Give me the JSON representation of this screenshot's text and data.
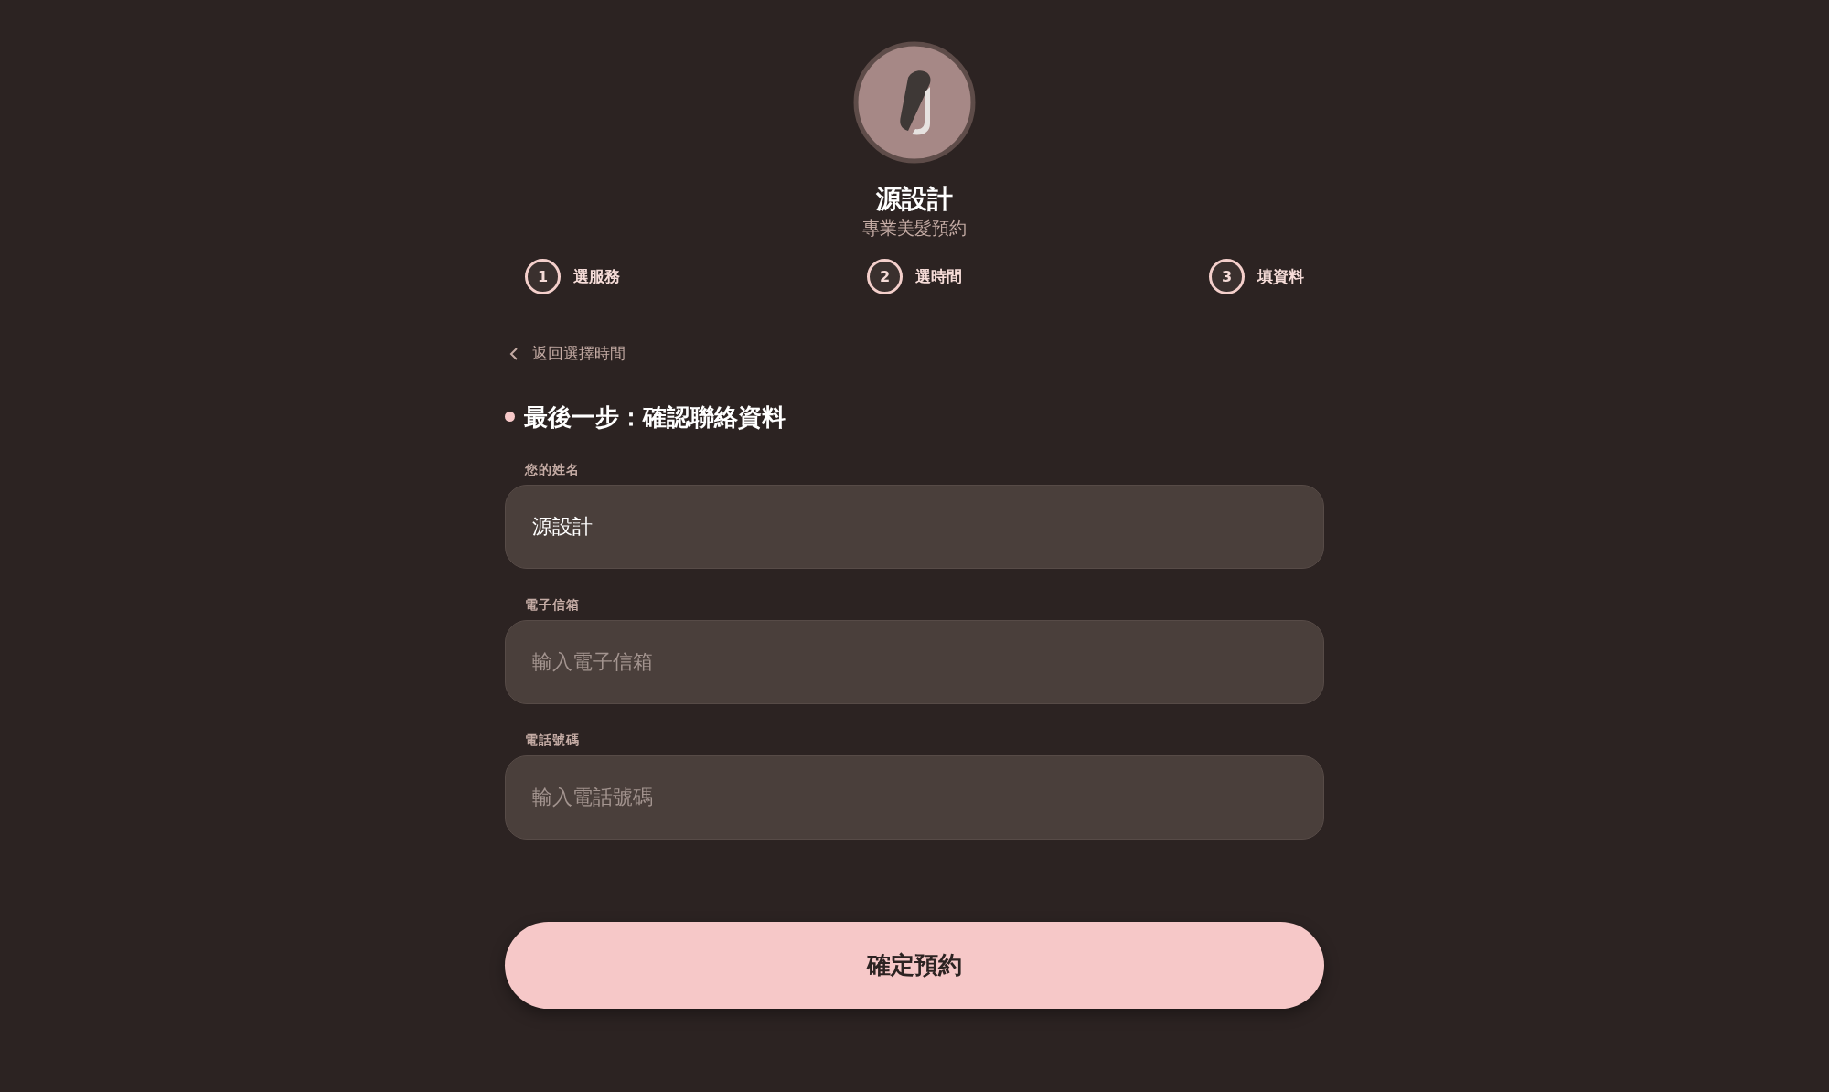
{
  "brand": {
    "name": "源設計",
    "tagline": "專業美髮預約"
  },
  "steps": [
    {
      "number": "1",
      "label": "選服務"
    },
    {
      "number": "2",
      "label": "選時間"
    },
    {
      "number": "3",
      "label": "填資料"
    }
  ],
  "back_link": "返回選擇時間",
  "heading": "最後一步：確認聯絡資料",
  "fields": [
    {
      "label": "您的姓名",
      "value": "源設計"
    },
    {
      "label": "電子信箱",
      "placeholder": "輸入電子信箱"
    },
    {
      "label": "電話號碼",
      "placeholder": "輸入電話號碼"
    }
  ],
  "submit_button": "確定預約"
}
